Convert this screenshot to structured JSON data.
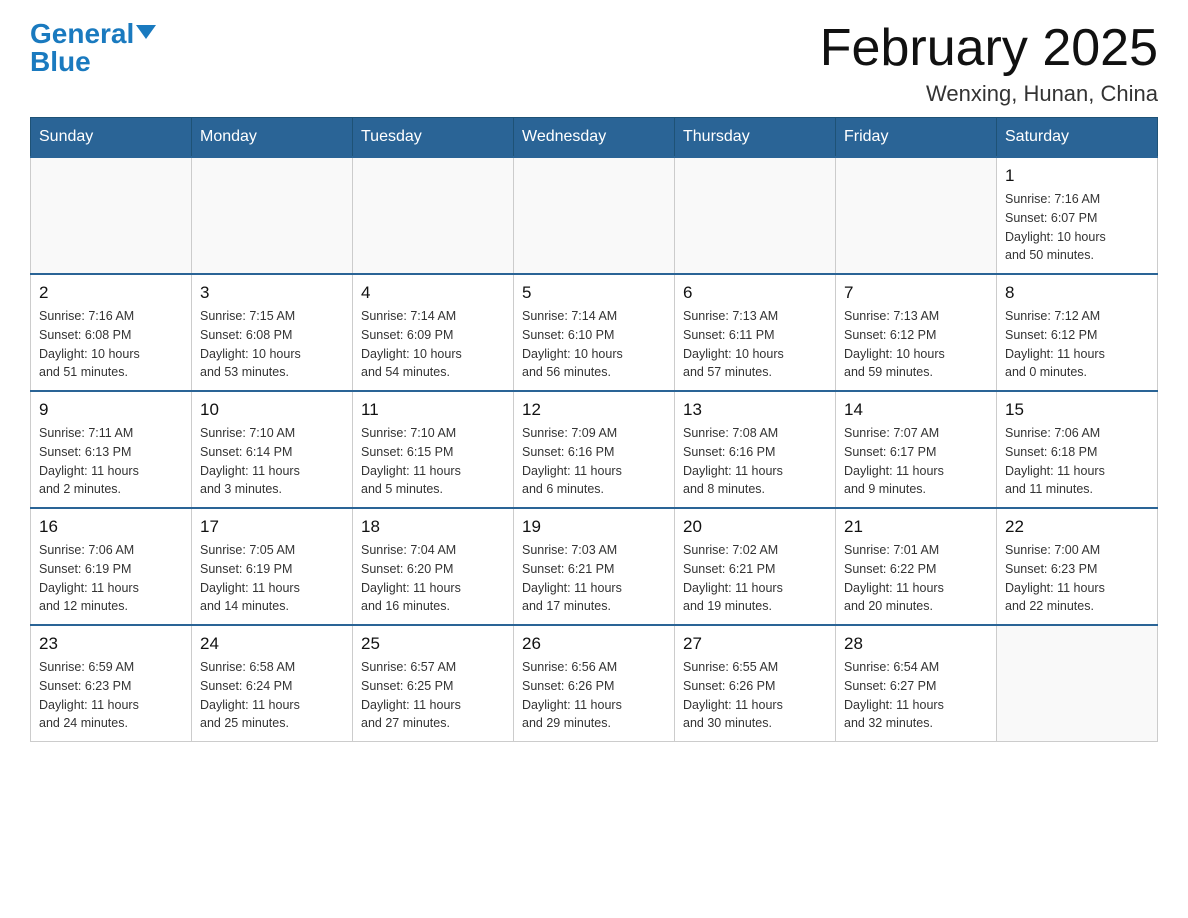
{
  "logo": {
    "general": "General",
    "blue": "Blue"
  },
  "title": "February 2025",
  "location": "Wenxing, Hunan, China",
  "days_of_week": [
    "Sunday",
    "Monday",
    "Tuesday",
    "Wednesday",
    "Thursday",
    "Friday",
    "Saturday"
  ],
  "weeks": [
    [
      {
        "day": "",
        "info": ""
      },
      {
        "day": "",
        "info": ""
      },
      {
        "day": "",
        "info": ""
      },
      {
        "day": "",
        "info": ""
      },
      {
        "day": "",
        "info": ""
      },
      {
        "day": "",
        "info": ""
      },
      {
        "day": "1",
        "info": "Sunrise: 7:16 AM\nSunset: 6:07 PM\nDaylight: 10 hours\nand 50 minutes."
      }
    ],
    [
      {
        "day": "2",
        "info": "Sunrise: 7:16 AM\nSunset: 6:08 PM\nDaylight: 10 hours\nand 51 minutes."
      },
      {
        "day": "3",
        "info": "Sunrise: 7:15 AM\nSunset: 6:08 PM\nDaylight: 10 hours\nand 53 minutes."
      },
      {
        "day": "4",
        "info": "Sunrise: 7:14 AM\nSunset: 6:09 PM\nDaylight: 10 hours\nand 54 minutes."
      },
      {
        "day": "5",
        "info": "Sunrise: 7:14 AM\nSunset: 6:10 PM\nDaylight: 10 hours\nand 56 minutes."
      },
      {
        "day": "6",
        "info": "Sunrise: 7:13 AM\nSunset: 6:11 PM\nDaylight: 10 hours\nand 57 minutes."
      },
      {
        "day": "7",
        "info": "Sunrise: 7:13 AM\nSunset: 6:12 PM\nDaylight: 10 hours\nand 59 minutes."
      },
      {
        "day": "8",
        "info": "Sunrise: 7:12 AM\nSunset: 6:12 PM\nDaylight: 11 hours\nand 0 minutes."
      }
    ],
    [
      {
        "day": "9",
        "info": "Sunrise: 7:11 AM\nSunset: 6:13 PM\nDaylight: 11 hours\nand 2 minutes."
      },
      {
        "day": "10",
        "info": "Sunrise: 7:10 AM\nSunset: 6:14 PM\nDaylight: 11 hours\nand 3 minutes."
      },
      {
        "day": "11",
        "info": "Sunrise: 7:10 AM\nSunset: 6:15 PM\nDaylight: 11 hours\nand 5 minutes."
      },
      {
        "day": "12",
        "info": "Sunrise: 7:09 AM\nSunset: 6:16 PM\nDaylight: 11 hours\nand 6 minutes."
      },
      {
        "day": "13",
        "info": "Sunrise: 7:08 AM\nSunset: 6:16 PM\nDaylight: 11 hours\nand 8 minutes."
      },
      {
        "day": "14",
        "info": "Sunrise: 7:07 AM\nSunset: 6:17 PM\nDaylight: 11 hours\nand 9 minutes."
      },
      {
        "day": "15",
        "info": "Sunrise: 7:06 AM\nSunset: 6:18 PM\nDaylight: 11 hours\nand 11 minutes."
      }
    ],
    [
      {
        "day": "16",
        "info": "Sunrise: 7:06 AM\nSunset: 6:19 PM\nDaylight: 11 hours\nand 12 minutes."
      },
      {
        "day": "17",
        "info": "Sunrise: 7:05 AM\nSunset: 6:19 PM\nDaylight: 11 hours\nand 14 minutes."
      },
      {
        "day": "18",
        "info": "Sunrise: 7:04 AM\nSunset: 6:20 PM\nDaylight: 11 hours\nand 16 minutes."
      },
      {
        "day": "19",
        "info": "Sunrise: 7:03 AM\nSunset: 6:21 PM\nDaylight: 11 hours\nand 17 minutes."
      },
      {
        "day": "20",
        "info": "Sunrise: 7:02 AM\nSunset: 6:21 PM\nDaylight: 11 hours\nand 19 minutes."
      },
      {
        "day": "21",
        "info": "Sunrise: 7:01 AM\nSunset: 6:22 PM\nDaylight: 11 hours\nand 20 minutes."
      },
      {
        "day": "22",
        "info": "Sunrise: 7:00 AM\nSunset: 6:23 PM\nDaylight: 11 hours\nand 22 minutes."
      }
    ],
    [
      {
        "day": "23",
        "info": "Sunrise: 6:59 AM\nSunset: 6:23 PM\nDaylight: 11 hours\nand 24 minutes."
      },
      {
        "day": "24",
        "info": "Sunrise: 6:58 AM\nSunset: 6:24 PM\nDaylight: 11 hours\nand 25 minutes."
      },
      {
        "day": "25",
        "info": "Sunrise: 6:57 AM\nSunset: 6:25 PM\nDaylight: 11 hours\nand 27 minutes."
      },
      {
        "day": "26",
        "info": "Sunrise: 6:56 AM\nSunset: 6:26 PM\nDaylight: 11 hours\nand 29 minutes."
      },
      {
        "day": "27",
        "info": "Sunrise: 6:55 AM\nSunset: 6:26 PM\nDaylight: 11 hours\nand 30 minutes."
      },
      {
        "day": "28",
        "info": "Sunrise: 6:54 AM\nSunset: 6:27 PM\nDaylight: 11 hours\nand 32 minutes."
      },
      {
        "day": "",
        "info": ""
      }
    ]
  ]
}
